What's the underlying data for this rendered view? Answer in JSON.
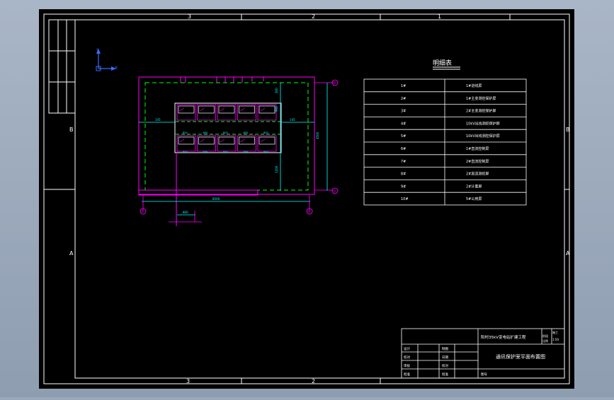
{
  "colors": {
    "paper": "#000000",
    "frame": "#ffffff",
    "wall": "#ff00ff",
    "dash": "#00ff00",
    "dim": "#00ffff",
    "cabinet": "#ff00ff",
    "panel": "#ffffff",
    "text": "#ffffff",
    "axis": "#3b6cff"
  },
  "border": {
    "top_zones": [
      "3",
      "2",
      "1"
    ],
    "bottom_zones": [
      "3",
      "2"
    ],
    "left_zones": [
      "B",
      "A"
    ],
    "right_zones": [
      "B",
      "A"
    ]
  },
  "ucs": {
    "y": "Y",
    "x": "X"
  },
  "plan": {
    "dims": {
      "left_offset": "145",
      "right_offset": "145",
      "total_width": "8500",
      "depth": "4500",
      "door": "800",
      "up_1": "300",
      "up_2": "900",
      "low": "1200"
    },
    "cabinet_labels": [
      "800",
      "800",
      "800",
      "800",
      "800"
    ],
    "grid": {
      "left": "①",
      "right": "②",
      "top": "Ⓑ",
      "bottom": "Ⓐ"
    }
  },
  "legend": {
    "title": "明细表",
    "rows": [
      {
        "no": "1#",
        "name": "1#进线屏"
      },
      {
        "no": "2#",
        "name": "1#主变测控保护屏"
      },
      {
        "no": "3#",
        "name": "2#主变测控保护屏"
      },
      {
        "no": "4#",
        "name": "10kV出线测控保护屏"
      },
      {
        "no": "5#",
        "name": "10kV出线测控保护屏"
      },
      {
        "no": "6#",
        "name": "1#直流控制屏"
      },
      {
        "no": "7#",
        "name": "2#直流控制屏"
      },
      {
        "no": "8#",
        "name": "2#直流测控屏"
      },
      {
        "no": "9#",
        "name": "2#计量屏"
      },
      {
        "no": "10#",
        "name": "5#公用屏"
      }
    ]
  },
  "titleblock": {
    "project": "阳村35kV变电站扩建工程",
    "drawing_title": "通讯保护室平面布置图",
    "stage_label": "阶段",
    "stage_value": "施工",
    "scale_label": "比例",
    "scale_value": "1:50",
    "designer_label": "设计",
    "checker_label": "校对",
    "reviewer_label": "审核",
    "approver_label": "批准",
    "drawn_label": "制图",
    "date_label": "日期",
    "drawing_no_label": "图号"
  }
}
